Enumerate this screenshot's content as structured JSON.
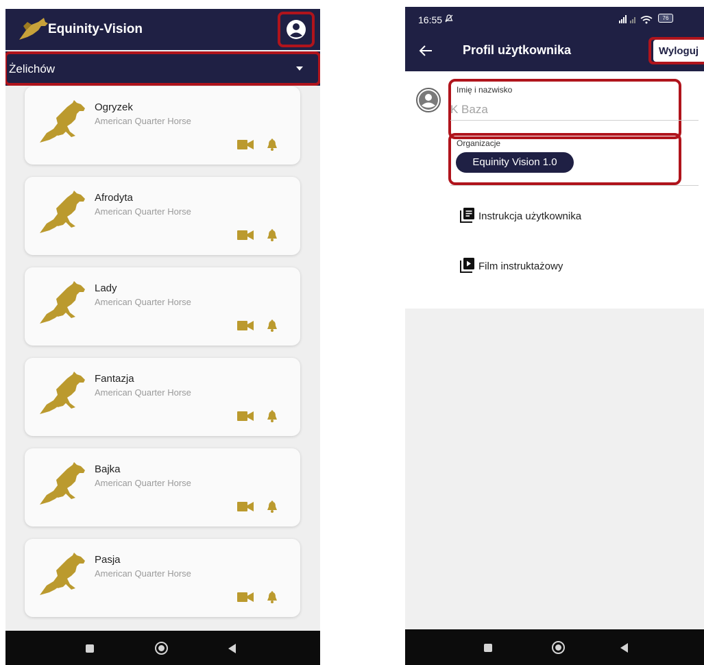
{
  "left_screen": {
    "app_title": "Equinity-Vision",
    "location": "Żelichów",
    "horses": [
      {
        "name": "Ogryzek",
        "breed": "American Quarter Horse"
      },
      {
        "name": "Afrodyta",
        "breed": "American Quarter Horse"
      },
      {
        "name": "Lady",
        "breed": "American Quarter Horse"
      },
      {
        "name": "Fantazja",
        "breed": "American Quarter Horse"
      },
      {
        "name": "Bajka",
        "breed": "American Quarter Horse"
      },
      {
        "name": "Pasja",
        "breed": "American Quarter Horse"
      }
    ]
  },
  "right_screen": {
    "status_time": "16:55",
    "battery": "76",
    "title": "Profil użytkownika",
    "logout_label": "Wyloguj",
    "name_label": "Imię i nazwisko",
    "name_value": "K Baza",
    "org_label": "Organizacje",
    "org_chip": "Equinity Vision 1.0",
    "menu": [
      {
        "label": "Instrukcja użytkownika",
        "icon": "document-list-icon"
      },
      {
        "label": "Film instruktażowy",
        "icon": "video-library-icon"
      }
    ]
  },
  "colors": {
    "primary": "#1f2044",
    "accent_gold": "#bb9a2e",
    "highlight": "#b0141c"
  }
}
